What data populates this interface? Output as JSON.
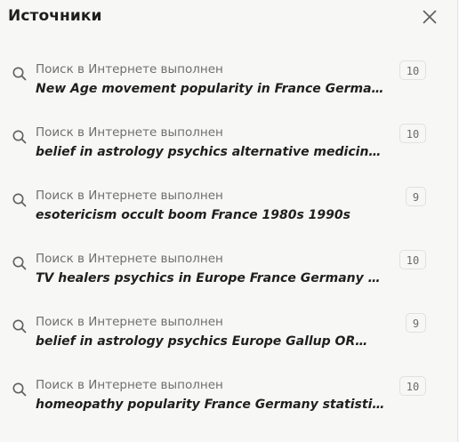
{
  "header": {
    "title": "Источники"
  },
  "items": [
    {
      "status": "Поиск в Интернете выполнен",
      "query": "New Age movement popularity in France Germany U…",
      "count": "10"
    },
    {
      "status": "Поиск в Интернете выполнен",
      "query": "belief in astrology psychics alternative medicine…",
      "count": "10"
    },
    {
      "status": "Поиск в Интернете выполнен",
      "query": "esotericism occult boom France 1980s 1990s",
      "count": "9"
    },
    {
      "status": "Поиск в Интернете выполнен",
      "query": "TV healers psychics in Europe France Germany UK…",
      "count": "10"
    },
    {
      "status": "Поиск в Интернете выполнен",
      "query": "belief in astrology psychics Europe Gallup OR…",
      "count": "9"
    },
    {
      "status": "Поиск в Интернете выполнен",
      "query": "homeopathy popularity France Germany statistics…",
      "count": "10"
    }
  ],
  "icons": {
    "search": "search-icon",
    "close": "close-icon"
  },
  "colors": {
    "background": "#f7f7f6",
    "title": "#1d1d1b",
    "status_text": "#6f6f6b",
    "query_text": "#1f1f1d",
    "badge_border": "#e1e1de"
  }
}
